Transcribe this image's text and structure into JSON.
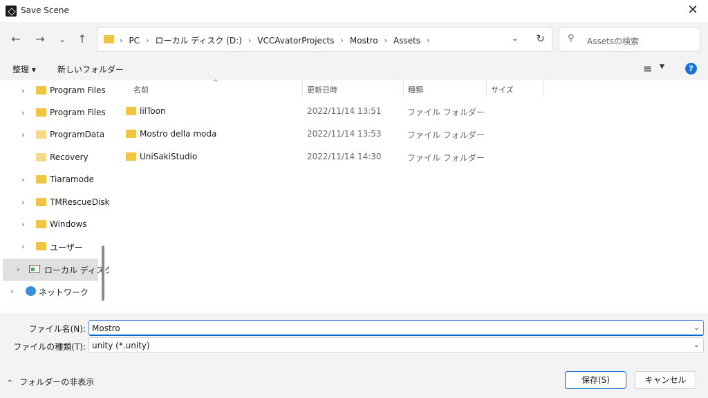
{
  "window": {
    "title": "Save Scene",
    "close_symbol": "✕"
  },
  "address_bar": {
    "crumbs": [
      "PC",
      "ローカル ディスク (D:)",
      "VCCAvatorProjects",
      "Mostro",
      "Assets"
    ],
    "search_placeholder": "Assetsの検索"
  },
  "toolbar": {
    "organize": "整理 ▾",
    "new_folder": "新しいフォルダー"
  },
  "sidebar": {
    "items": [
      {
        "label": "Program Files"
      },
      {
        "label": "Program Files"
      },
      {
        "label": "ProgramData"
      },
      {
        "label": "Recovery"
      },
      {
        "label": "Tiaramode"
      },
      {
        "label": "TMRescueDisk"
      },
      {
        "label": "Windows"
      },
      {
        "label": "ユーザー"
      },
      {
        "label": "ローカル ディスク"
      },
      {
        "label": "ネットワーク"
      }
    ]
  },
  "columns": {
    "name": "名前",
    "date": "更新日時",
    "type": "種類",
    "size": "サイズ"
  },
  "files": [
    {
      "name": "lilToon",
      "date": "2022/11/14 13:51",
      "type": "ファイル フォルダー"
    },
    {
      "name": "Mostro della moda",
      "date": "2022/11/14 13:53",
      "type": "ファイル フォルダー"
    },
    {
      "name": "UniSakiStudio",
      "date": "2022/11/14 14:30",
      "type": "ファイル フォルダー"
    }
  ],
  "form": {
    "filename_label": "ファイル名(N):",
    "filename_value": "Mostro",
    "filetype_label": "ファイルの種類(T):",
    "filetype_value": "unity (*.unity)"
  },
  "footer": {
    "hide_folders": "フォルダーの非表示",
    "save": "保存(S)",
    "cancel": "キャンセル"
  },
  "colors": {
    "accent": "#0a66c8",
    "folder": "#f2c445",
    "help": "#1a73d9"
  }
}
